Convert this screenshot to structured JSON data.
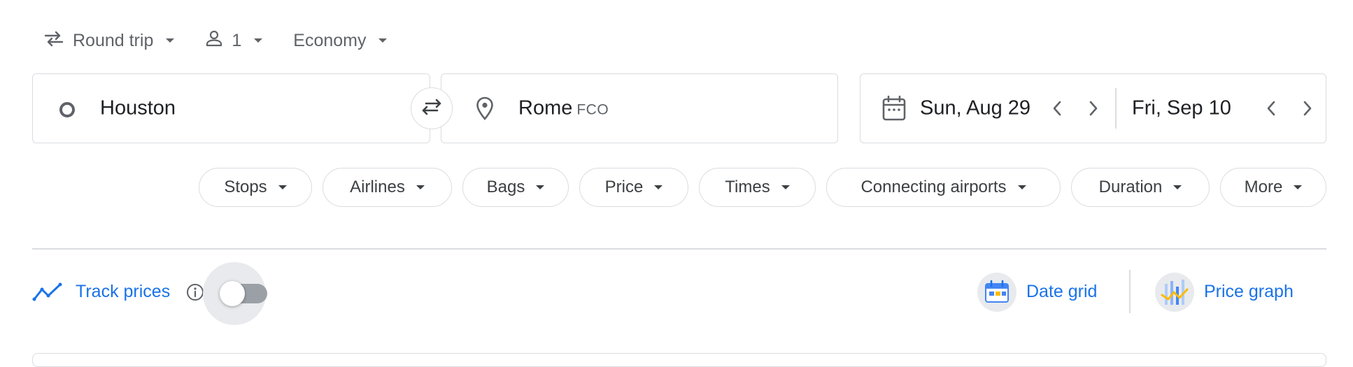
{
  "trip_options": {
    "trip_type": "Round trip",
    "passengers": "1",
    "cabin_class": "Economy"
  },
  "search": {
    "origin": "Houston",
    "destination": "Rome",
    "destination_code": "FCO",
    "depart_date": "Sun, Aug 29",
    "return_date": "Fri, Sep 10"
  },
  "filters": [
    {
      "label": "Stops"
    },
    {
      "label": "Airlines"
    },
    {
      "label": "Bags"
    },
    {
      "label": "Price"
    },
    {
      "label": "Times"
    },
    {
      "label": "Connecting airports"
    },
    {
      "label": "Duration"
    },
    {
      "label": "More"
    }
  ],
  "tools": {
    "track_prices_label": "Track prices",
    "track_prices_enabled": false,
    "date_grid_label": "Date grid",
    "price_graph_label": "Price graph"
  },
  "colors": {
    "accent": "#1a73e8",
    "border": "#dadce0",
    "text": "#202124",
    "muted": "#5f6368"
  },
  "icons": [
    "swap-arrows-icon",
    "person-icon",
    "origin-circle-icon",
    "swap-icon",
    "location-pin-icon",
    "calendar-icon",
    "chevron-left-icon",
    "chevron-right-icon",
    "trend-icon",
    "info-icon",
    "date-grid-icon",
    "price-graph-icon"
  ]
}
